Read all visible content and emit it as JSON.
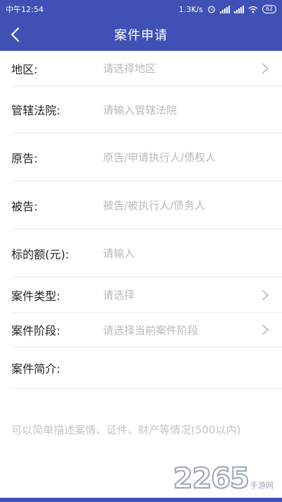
{
  "status_bar": {
    "time": "中午12:54",
    "net_speed": "1.3K/s",
    "battery": "62"
  },
  "app_bar": {
    "title": "案件申请"
  },
  "form": {
    "region": {
      "label": "地区:",
      "placeholder": "请选择地区"
    },
    "court": {
      "label": "管辖法院:",
      "placeholder": "请输入管辖法院"
    },
    "plaintiff": {
      "label": "原告:",
      "placeholder": "原告/申请执行人/债权人"
    },
    "defendant": {
      "label": "被告:",
      "placeholder": "被告/被执行人/债务人"
    },
    "amount": {
      "label": "标的额(元):",
      "placeholder": "请输入"
    },
    "case_type": {
      "label": "案件类型:",
      "placeholder": "请选择"
    },
    "case_stage": {
      "label": "案件阶段:",
      "placeholder": "请选择当前案件阶段"
    },
    "case_intro": {
      "label": "案件简介:",
      "placeholder": "可以简单描述案情、证件、财产等情况(500以内)"
    }
  },
  "watermark": {
    "digits": "2265",
    "text": "手游网"
  },
  "colors": {
    "primary": "#3f51b5",
    "placeholder": "#b9b9b9"
  }
}
